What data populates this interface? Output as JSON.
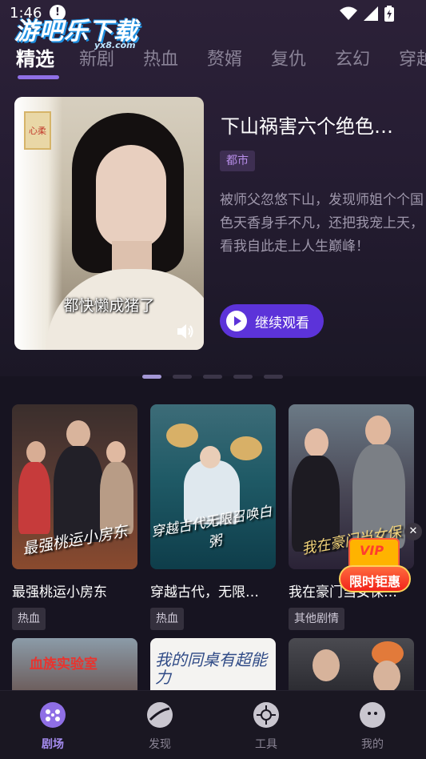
{
  "status_bar": {
    "time": "1:46",
    "info_glyph": "!"
  },
  "watermark": {
    "text": "游吧乐下载",
    "sub": "yx8.com"
  },
  "tabs": [
    {
      "label": "精选",
      "active": true
    },
    {
      "label": "新剧",
      "active": false
    },
    {
      "label": "热血",
      "active": false
    },
    {
      "label": "赘婿",
      "active": false
    },
    {
      "label": "复仇",
      "active": false
    },
    {
      "label": "玄幻",
      "active": false
    },
    {
      "label": "穿越",
      "active": false
    }
  ],
  "featured": {
    "poster_sign": "心柔",
    "caption": "都快懒成猪了",
    "title": "下山祸害六个绝色…",
    "tag": "都市",
    "description": "被师父忽悠下山，发现师姐个个国色天香身手不凡，还把我宠上天，看我自此走上人生巅峰！",
    "continue_label": "继续观看"
  },
  "carousel": {
    "count": 5,
    "active_index": 0
  },
  "dramas": [
    {
      "title": "最强桃运小房东",
      "tag": "热血",
      "poster_text": "最强桃运小房东"
    },
    {
      "title": "穿越古代，无限…",
      "tag": "热血",
      "poster_text": "穿越古代无限召唤白粥"
    },
    {
      "title": "我在豪门当女保…",
      "tag": "其他剧情",
      "poster_text": "我在豪门当女保"
    }
  ],
  "dramas_row2": [
    {
      "poster_text": "血族实验室"
    },
    {
      "poster_text": "我的同桌有超能力"
    },
    {
      "poster_text": ""
    }
  ],
  "promo": {
    "vip": "VIP",
    "label": "限时钜惠",
    "close": "✕"
  },
  "bottom_nav": [
    {
      "label": "剧场",
      "icon": "theater-icon",
      "active": true
    },
    {
      "label": "发现",
      "icon": "planet-icon",
      "active": false
    },
    {
      "label": "工具",
      "icon": "aperture-icon",
      "active": false
    },
    {
      "label": "我的",
      "icon": "face-icon",
      "active": false
    }
  ],
  "colors": {
    "accent": "#5c33d9",
    "active_tab_line": "#8f6fe6",
    "background": "#171421"
  }
}
